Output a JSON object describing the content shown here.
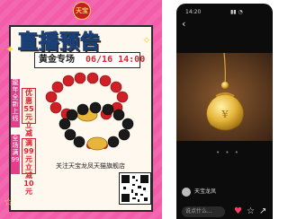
{
  "poster": {
    "logo": "天宝",
    "title": "直播预告",
    "topic": "黄金专场",
    "time": "06/16 14:00",
    "band_left_top": "龍年全新上线",
    "badge_top": "优惠55元立减",
    "band_left_bottom": "全场满99",
    "badge_bottom": "满99元立减10元",
    "caption": "关注天宝龙凤天猫旗舰店"
  },
  "phone": {
    "status_time": "14:20",
    "status_icons": "▮▮ ◔",
    "username": "天宝龙凤",
    "comment_placeholder": "说点什么...",
    "page_dots": "• • •"
  },
  "colors": {
    "poster_pink": "#f25ca9",
    "title_blue": "#3c8ee8",
    "time_red": "#d9232d",
    "gold": "#e6b53a"
  }
}
